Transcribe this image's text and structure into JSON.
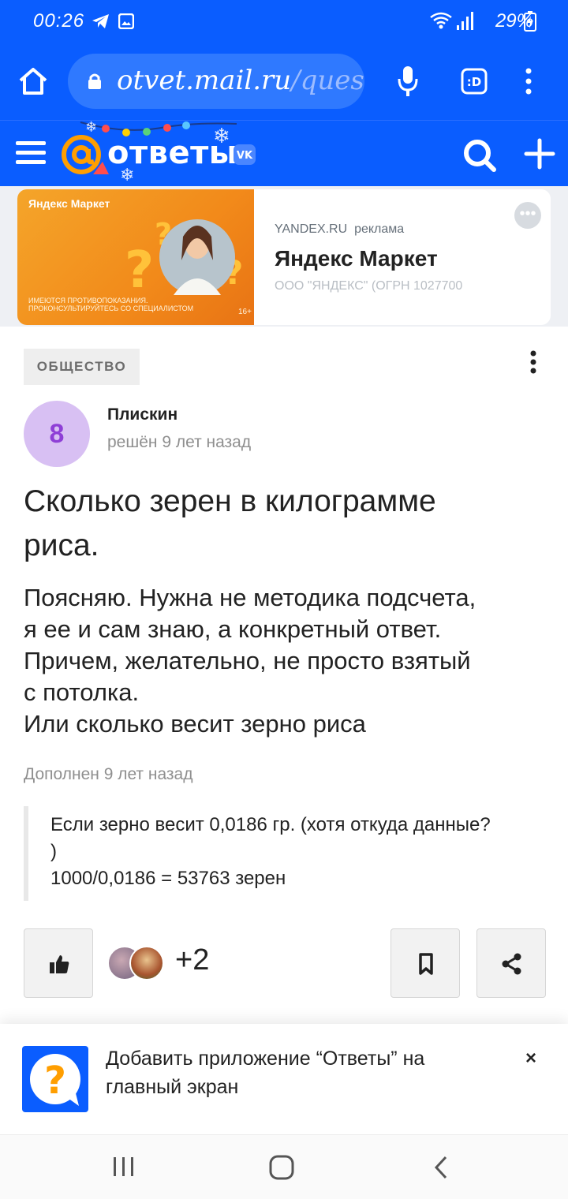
{
  "status_bar": {
    "time": "00:26",
    "battery": "29%",
    "icons": [
      "telegram-icon",
      "gallery-icon",
      "wifi-icon",
      "signal-icon",
      "battery-charging-icon"
    ]
  },
  "browser": {
    "url_host": "otvet.mail.ru",
    "url_path": "/ques",
    "icons": [
      "home-icon",
      "lock-icon",
      "microphone-icon",
      "tab-switcher-icon",
      "more-vertical-icon"
    ]
  },
  "site_header": {
    "logo_text": "ответы",
    "vk_badge": "VK",
    "icons": [
      "menu-icon",
      "at-sign-logo",
      "search-icon",
      "plus-icon"
    ]
  },
  "ad": {
    "image_brand": "Яндекс Маркет",
    "image_fine_1": "ИМЕЮТСЯ ПРОТИВОПОКАЗАНИЯ.",
    "image_fine_2": "ПРОКОНСУЛЬТИРУЙТЕСЬ СО СПЕЦИАЛИСТОМ",
    "image_age": "16+",
    "source": "YANDEX.RU",
    "label": "реклама",
    "title": "Яндекс Маркет",
    "org": "ООО \"ЯНДЕКС\" (ОГРН 1027700",
    "more": "•••"
  },
  "question": {
    "category": "ОБЩЕСТВО",
    "avatar_letter": "8",
    "author": "Плискин",
    "status": "решён 9 лет назад",
    "title_line1": "Сколько зерен в килограмме",
    "title_line2": "риса.",
    "body_lines": [
      "Поясняю. Нужна не методика подсчета,",
      "я ее и сам знаю, а конкретный ответ.",
      "Причем, желательно, не просто взятый",
      "с потолка.",
      "Или сколько весит зерно риса"
    ],
    "added_label": "Дополнен 9 лет назад",
    "addendum_lines": [
      "Если зерно весит 0,0186 гр. (хотя откуда данные?",
      ")",
      "1000/0,0186 = 53763 зерен"
    ]
  },
  "actions": {
    "likers_extra": "+2",
    "icons": [
      "thumbs-up-icon",
      "bookmark-icon",
      "share-icon"
    ]
  },
  "install_banner": {
    "line1": "Добавить приложение “Ответы” на",
    "line2": "главный экран",
    "close": "×"
  },
  "nav_bar": {
    "icons": [
      "recent-apps-icon",
      "home-button-icon",
      "back-icon"
    ]
  },
  "colors": {
    "brand_blue": "#0a5dff",
    "logo_orange": "#ff9e00",
    "avatar_bg": "#d8c0f3",
    "avatar_fg": "#8e3fd6"
  }
}
